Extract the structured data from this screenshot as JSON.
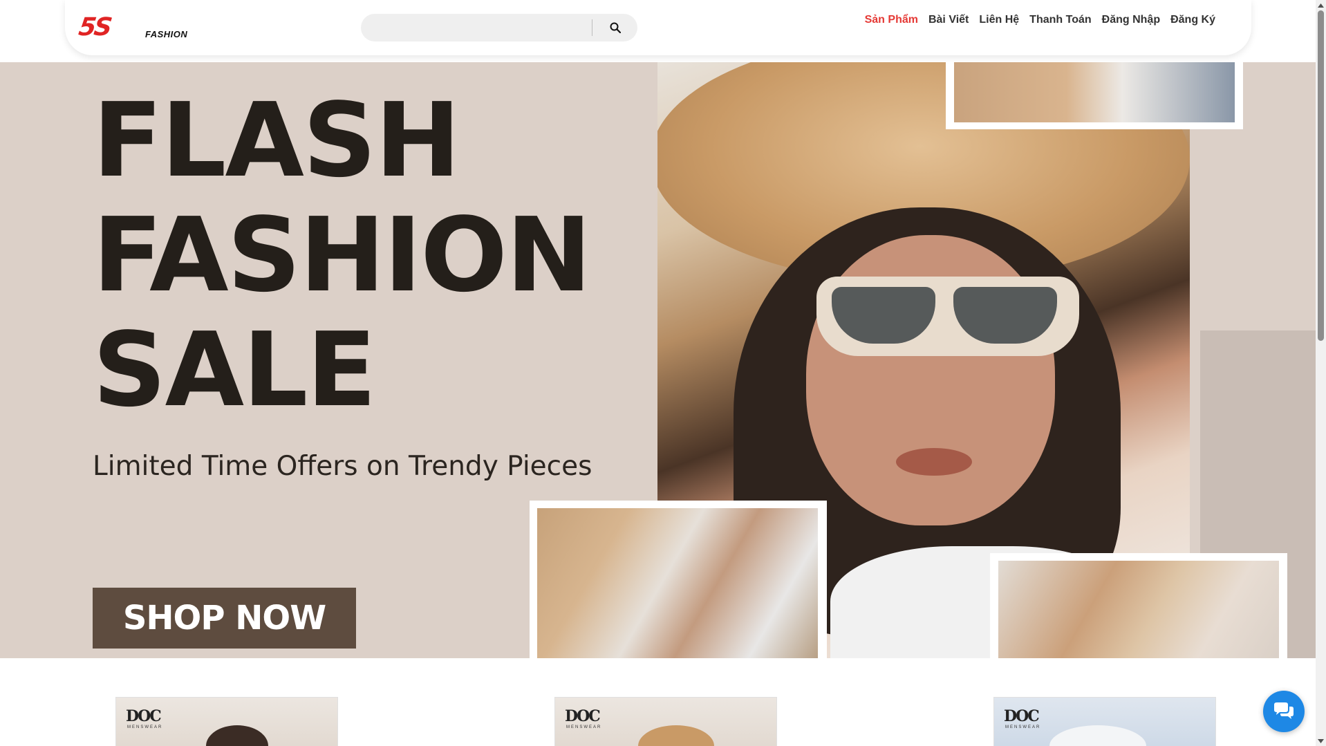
{
  "header": {
    "logo_mark": "5S",
    "logo_text": "FASHION",
    "search": {
      "value": "",
      "placeholder": ""
    },
    "search_icon": "search-icon",
    "nav": [
      {
        "label": "Sản Phẩm",
        "active": true
      },
      {
        "label": "Bài Viết",
        "active": false
      },
      {
        "label": "Liên Hệ",
        "active": false
      },
      {
        "label": "Thanh Toán",
        "active": false
      },
      {
        "label": "Đăng Nhập",
        "active": false
      },
      {
        "label": "Đăng Ký",
        "active": false
      }
    ]
  },
  "banner": {
    "headline": [
      "FLASH",
      "FASHION",
      "SALE"
    ],
    "tagline": "Limited Time Offers on Trendy Pieces",
    "cta_label": "SHOP NOW"
  },
  "products": [
    {
      "brand": "DOC",
      "brand_sub": "MENSWEAR"
    },
    {
      "brand": "DOC",
      "brand_sub": "MENSWEAR"
    },
    {
      "brand": "DOC",
      "brand_sub": "MENSWEAR"
    }
  ],
  "chat_icon": "chat-bubbles-icon",
  "colors": {
    "accent": "#e53935",
    "banner_bg": "#dcd0c8",
    "cta_bg": "#5e4c3f",
    "headline": "#241f1a",
    "chat_button": "#1e88e5"
  }
}
